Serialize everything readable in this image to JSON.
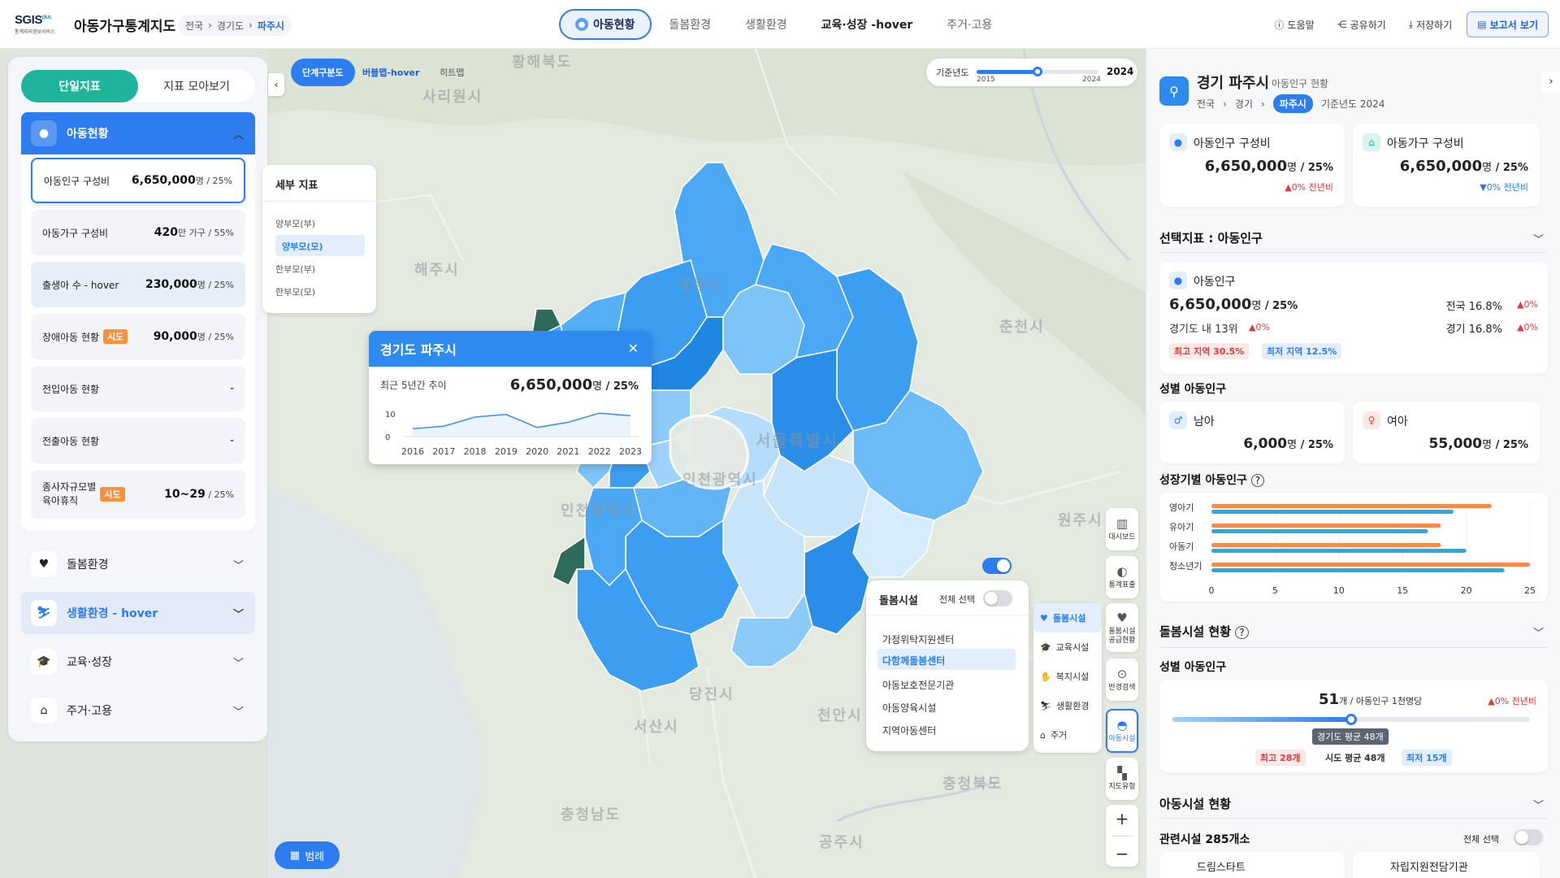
{
  "header": {
    "logo_main": "SGIS",
    "logo_sup": "plus",
    "logo_sub": "통계지리정보서비스",
    "brand": "아동가구통계지도",
    "breadcrumb": [
      "전국",
      "경기도",
      "파주시"
    ],
    "tabs": [
      {
        "label": "아동현황",
        "state": "active"
      },
      {
        "label": "돌봄환경",
        "state": "normal"
      },
      {
        "label": "생활환경",
        "state": "normal"
      },
      {
        "label": "교육·성장 -hover",
        "state": "hover"
      },
      {
        "label": "주거·고용",
        "state": "normal"
      }
    ],
    "actions": {
      "help": "도움말",
      "share": "공유하기",
      "save": "저장하기",
      "report": "보고서 보기"
    }
  },
  "left": {
    "seg": [
      "단일지표",
      "지표 모아보기"
    ],
    "main_category": "아동현황",
    "items": [
      {
        "label": "아동인구 구성비",
        "value": "6,650,000",
        "unit": "명",
        "pct": " / 25%",
        "badge": ""
      },
      {
        "label": "아동가구 구성비",
        "value": "420",
        "unit": "만 가구",
        "pct": " / 55%",
        "badge": ""
      },
      {
        "label": "출생아 수 - hover",
        "value": "230,000",
        "unit": "명",
        "pct": " / 25%",
        "badge": ""
      },
      {
        "label": "장애아동 현황",
        "value": "90,000",
        "unit": "명",
        "pct": " / 25%",
        "badge": "시도"
      },
      {
        "label": "전입아동 현황",
        "value": "-",
        "unit": "",
        "pct": "",
        "badge": ""
      },
      {
        "label": "전출아동 현황",
        "value": "-",
        "unit": "",
        "pct": "",
        "badge": ""
      },
      {
        "label1": "종사자규모별",
        "label2": "육아휴직",
        "value": "10~29",
        "unit": "",
        "pct": " / 25%",
        "badge": "시도"
      }
    ],
    "categories": [
      {
        "label": "돌봄환경",
        "icon": "heart-icon",
        "state": "normal"
      },
      {
        "label": "생활환경 - hover",
        "icon": "sled-icon",
        "state": "hover"
      },
      {
        "label": "교육·성장",
        "icon": "graduation-cap-icon",
        "state": "normal"
      },
      {
        "label": "주거·고용",
        "icon": "house-icon",
        "state": "normal"
      }
    ]
  },
  "map": {
    "view_tabs": [
      "단계구분도",
      "버블맵-hover",
      "히트맵"
    ],
    "year": {
      "label": "기준년도",
      "min": "2015",
      "max": "2024",
      "value": "2024",
      "fraction": 0.5
    },
    "detail": {
      "title": "세부 지표",
      "items": [
        "양부모(부)",
        "양부모(모)",
        "한부모(부)",
        "한부모(모)"
      ],
      "selected": 1
    },
    "labels": [
      "황해북도",
      "사리원시",
      "해주시",
      "개성시",
      "춘천시",
      "서울특별시",
      "인천광역시",
      "인천광역시",
      "원주시",
      "당진시",
      "서산시",
      "천안시",
      "충청북도",
      "충청남도",
      "공주시"
    ],
    "popup": {
      "title": "경기도 파주시",
      "sub": "최근 5년간 추이",
      "value": "6,650,000",
      "unit": "명",
      "pct": " / 25%",
      "y_ticks": [
        "10",
        "0"
      ],
      "x": [
        "2016",
        "2017",
        "2018",
        "2019",
        "2020",
        "2021",
        "2022",
        "2023"
      ],
      "values": [
        3,
        4,
        7.5,
        8.5,
        3.5,
        5.5,
        9,
        8
      ]
    },
    "facility": {
      "title": "돌봄시설",
      "select_all": "전체 선택",
      "items": [
        "가정위탁지원센터",
        "다함께돌봄센터",
        "아동보호전문기관",
        "아동양육시설",
        "지역아동센터"
      ],
      "selected": 1
    },
    "fac_categories": [
      {
        "label": "돌봄시설",
        "icon": "heart-icon"
      },
      {
        "label": "교육시설",
        "icon": "graduation-cap-icon"
      },
      {
        "label": "복지시설",
        "icon": "hands-icon"
      },
      {
        "label": "생활환경",
        "icon": "sled-icon"
      },
      {
        "label": "주거",
        "icon": "house-icon"
      }
    ],
    "rail": [
      {
        "l1": "대시보드",
        "l2": "",
        "icon": "chart-icon"
      },
      {
        "l1": "통계표출",
        "l2": "",
        "icon": "toggle-icon"
      },
      {
        "l1": "돌봄시설",
        "l2": "공급현황",
        "icon": "heart-icon"
      },
      {
        "l1": "반경검색",
        "l2": "",
        "icon": "pin-icon"
      },
      {
        "l1": "아동시설",
        "l2": "",
        "icon": "hat-icon"
      },
      {
        "l1": "지도유형",
        "l2": "",
        "icon": "map-icon"
      }
    ],
    "legend": "범례"
  },
  "right": {
    "title": "경기 파주시",
    "subtitle": "아동인구 현황",
    "breadcrumb": [
      "전국",
      "경기",
      "파주시"
    ],
    "base_year": "기준년도 2024",
    "summary": [
      {
        "label": "아동인구 구성비",
        "value": "6,650,000",
        "unit": "명",
        "pct": " / 25%",
        "delta": "0% 전년비",
        "dir": "up"
      },
      {
        "label": "아동가구 구성비",
        "value": "6,650,000",
        "unit": "명",
        "pct": " / 25%",
        "delta": "0% 전년비",
        "dir": "down"
      }
    ],
    "selected_title": "선택지표 : 아동인구",
    "selected": {
      "label": "아동인구",
      "value": "6,650,000",
      "unit": "명",
      "pct": " / 25%",
      "nat": "전국 16.8%",
      "nat_delta": "0%",
      "rank": "경기도 내 13위",
      "rank_delta": "0%",
      "gg": "경기 16.8%",
      "gg_delta": "0%",
      "max": "최고 지역 30.5%",
      "min": "최저 지역 12.5%"
    },
    "gender_title": "성별 아동인구",
    "gender": [
      {
        "label": "남아",
        "value": "6,000",
        "unit": "명",
        "pct": " / 25%"
      },
      {
        "label": "여아",
        "value": "55,000",
        "unit": "명",
        "pct": " / 25%"
      }
    ],
    "growth_title": "성장기별 아동인구",
    "chart_data": {
      "type": "bar",
      "orientation": "horizontal",
      "categories": [
        "영아기",
        "유아기",
        "아동기",
        "청소년기"
      ],
      "series": [
        {
          "color": "#f7894a",
          "values": [
            22,
            18,
            18,
            25
          ]
        },
        {
          "color": "#2aa8e0",
          "values": [
            19,
            17,
            20,
            23
          ]
        }
      ],
      "xticks": [
        "0",
        "5",
        "10",
        "15",
        "20",
        "25"
      ],
      "xlim": [
        0,
        25
      ]
    },
    "care_title": "돌봄시설 현황",
    "care_sub": "성별 아동인구",
    "care": {
      "value": "51",
      "unit": "개 / 아동인구 1천명당",
      "delta": "0% 전년비",
      "fraction": 0.5,
      "avg_tip": "경기도 평균 48개",
      "max": "최고 28개",
      "avg": "시도 평균 48개",
      "min": "최저 15개"
    },
    "kids_title": "아동시설 현황",
    "kids_count": "관련시설 285개소",
    "kids_select_all": "전체 선택",
    "kids_cards": [
      "드림스타트",
      "자립지원전담기관"
    ]
  }
}
